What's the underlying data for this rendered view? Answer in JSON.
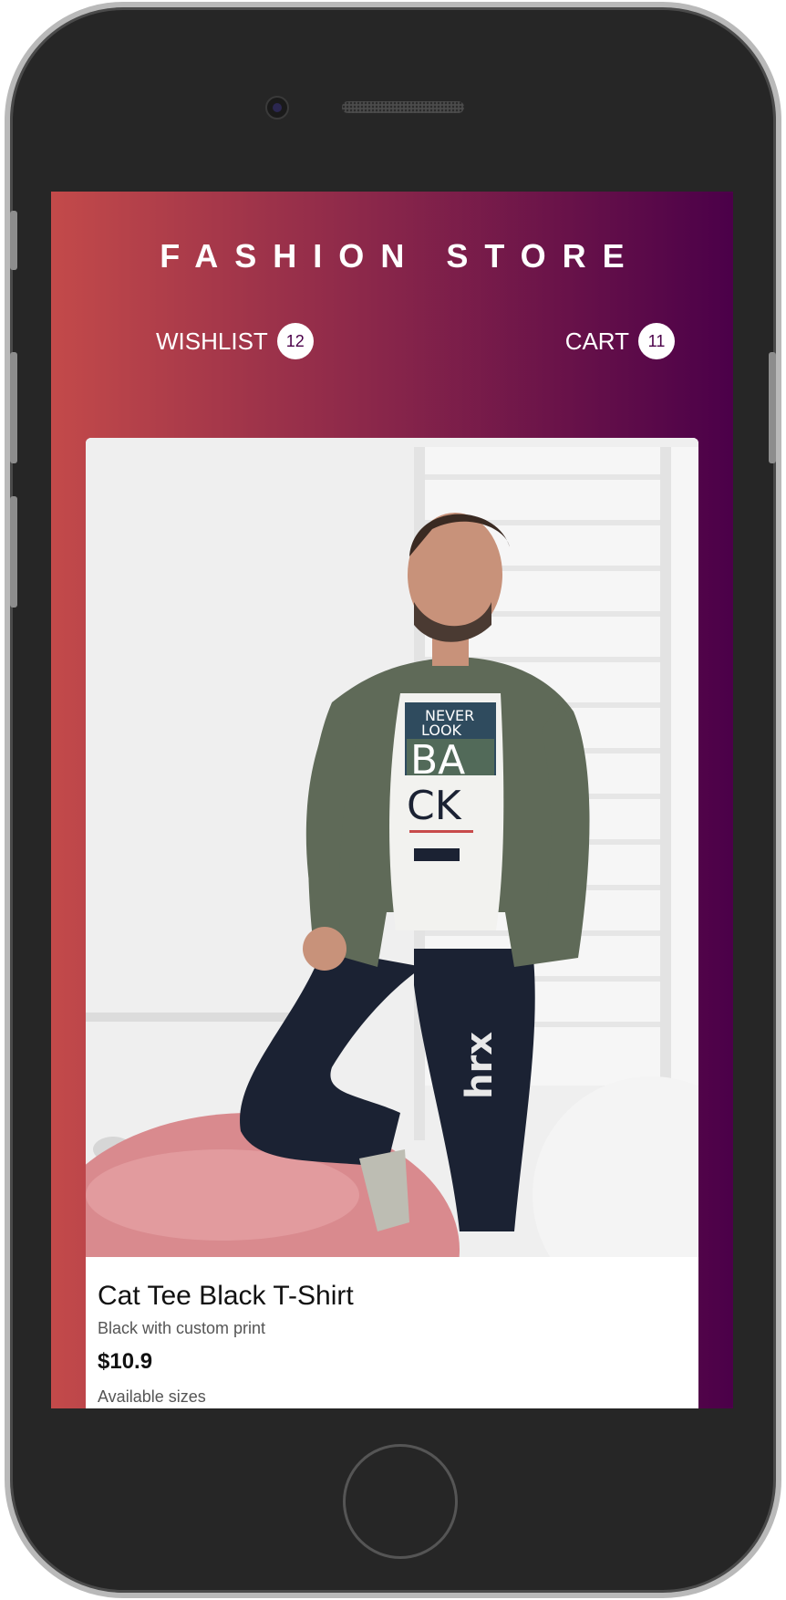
{
  "store": {
    "title": "FASHION STORE"
  },
  "nav": {
    "wishlist_label": "WISHLIST",
    "wishlist_count": "12",
    "cart_label": "CART",
    "cart_count": "11"
  },
  "product": {
    "name": "Cat Tee Black T-Shirt",
    "description": "Black with custom print",
    "price": "$10.9",
    "sizes_label": "Available sizes",
    "image_icon": "product-photo-man-in-jacket",
    "shirt_print": {
      "line1": "NEVER",
      "line2": "LOOK",
      "line3": "BA",
      "line4": "CK"
    },
    "pants_logo": "hrx"
  },
  "colors": {
    "gradient_start": "#c34a4a",
    "gradient_end": "#4b0049",
    "badge_text": "#4b0049"
  }
}
